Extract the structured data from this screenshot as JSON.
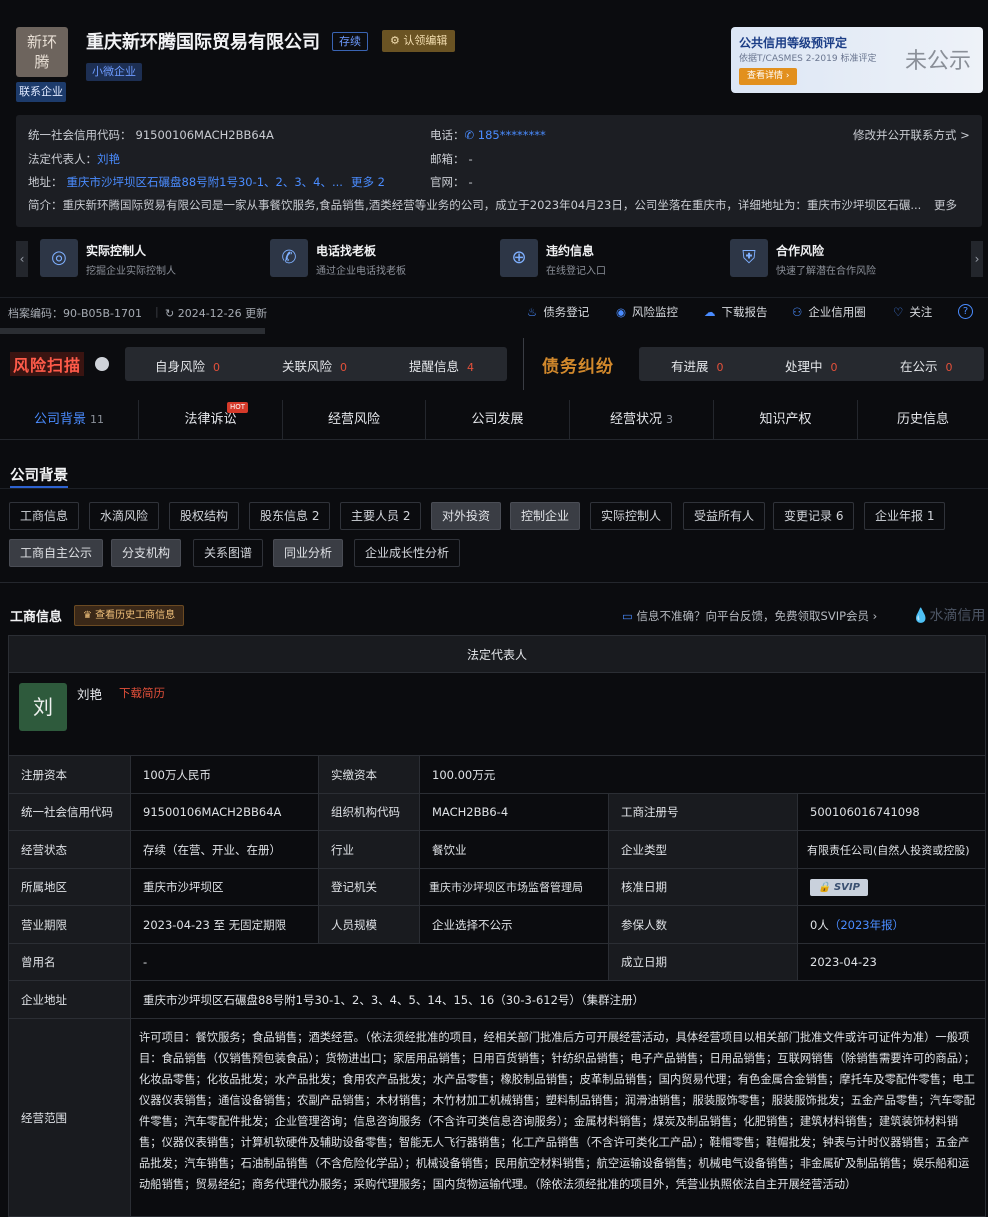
{
  "header": {
    "logo_text": "新环腾",
    "contact_badge": "联系企业",
    "company_name": "重庆新环腾国际贸易有限公司",
    "status": "存续",
    "claim": "认领编辑",
    "size_tag": "小微企业"
  },
  "credit_card": {
    "title": "公共信用等级预评定",
    "subtitle": "依据T/CASMES 2-2019 标准评定",
    "button": "查看详情",
    "result": "未公示"
  },
  "info": {
    "credit_code_label": "统一社会信用代码：",
    "credit_code": "91500106MACH2BB64A",
    "phone_label": "电话：",
    "phone": "185********",
    "modify": "修改并公开联系方式 >",
    "legal_label": "法定代表人：",
    "legal": "刘艳",
    "email_label": "邮箱：",
    "email": "-",
    "address_label": "地址：",
    "address": "重庆市沙坪坝区石碾盘88号附1号30-1、2、3、4、...",
    "address_more": "更多 2",
    "website_label": "官网：",
    "website": "-",
    "intro_label": "简介：",
    "intro": "重庆新环腾国际贸易有限公司是一家从事餐饮服务,食品销售,酒类经营等业务的公司，成立于2023年04月23日，公司坐落在重庆市，详细地址为：重庆市沙坪坝区石碾...",
    "intro_more": "更多"
  },
  "features": [
    {
      "title": "实际控制人",
      "sub": "挖掘企业实际控制人",
      "icon": "target-icon"
    },
    {
      "title": "电话找老板",
      "sub": "通过企业电话找老板",
      "icon": "phone-icon"
    },
    {
      "title": "违约信息",
      "sub": "在线登记入口",
      "icon": "user-add-icon"
    },
    {
      "title": "合作风险",
      "sub": "快速了解潜在合作风险",
      "icon": "shield-icon"
    }
  ],
  "archive": {
    "code_label": "档案编码：",
    "code": "90-B05B-1701",
    "updated": "2024-12-26 更新"
  },
  "toolbar": {
    "debt": "债务登记",
    "monitor": "风险监控",
    "report": "下载报告",
    "circle": "企业信用圈",
    "follow": "关注",
    "help": "?"
  },
  "risk": {
    "logo": "风险扫描",
    "items": [
      {
        "label": "自身风险",
        "count": "0"
      },
      {
        "label": "关联风险",
        "count": "0"
      },
      {
        "label": "提醒信息",
        "count": "4"
      }
    ],
    "debt_logo": "债务纠纷",
    "debt_items": [
      {
        "label": "有进展",
        "count": "0"
      },
      {
        "label": "处理中",
        "count": "0"
      },
      {
        "label": "在公示",
        "count": "0"
      }
    ]
  },
  "tabs": [
    {
      "label": "公司背景",
      "count": "11"
    },
    {
      "label": "法律诉讼",
      "count": "",
      "hot": "HOT"
    },
    {
      "label": "经营风险",
      "count": ""
    },
    {
      "label": "公司发展",
      "count": ""
    },
    {
      "label": "经营状况",
      "count": "3"
    },
    {
      "label": "知识产权",
      "count": ""
    },
    {
      "label": "历史信息",
      "count": ""
    }
  ],
  "section": {
    "title": "公司背景"
  },
  "chips": [
    "工商信息",
    "水滴风险",
    "股权结构",
    "股东信息 2",
    "主要人员 2",
    "对外投资",
    "控制企业",
    "实际控制人",
    "受益所有人",
    "变更记录 6",
    "企业年报 1",
    "工商自主公示",
    "分支机构",
    "关系图谱",
    "同业分析",
    "企业成长性分析"
  ],
  "biz": {
    "title": "工商信息",
    "history_btn": "查看历史工商信息",
    "feedback": "信息不准确？向平台反馈，免费领取SVIP会员 ›",
    "watermark": "水滴信用",
    "legal_header": "法定代表人",
    "avatar": "刘",
    "legal_name": "刘艳",
    "resume": "下载简历"
  },
  "table": {
    "reg_capital_k": "注册资本",
    "reg_capital": "100万人民币",
    "paid_k": "实缴资本",
    "paid": "100.00万元",
    "code_k": "统一社会信用代码",
    "code": "91500106MACH2BB64A",
    "org_k": "组织机构代码",
    "org": "MACH2BB6-4",
    "regno_k": "工商注册号",
    "regno": "500106016741098",
    "status_k": "经营状态",
    "status": "存续（在营、开业、在册）",
    "industry_k": "行业",
    "industry": "餐饮业",
    "type_k": "企业类型",
    "type": "有限责任公司(自然人投资或控股)",
    "area_k": "所属地区",
    "area": "重庆市沙坪坝区",
    "authority_k": "登记机关",
    "authority": "重庆市沙坪坝区市场监督管理局",
    "approve_k": "核准日期",
    "approve": "SVIP",
    "term_k": "营业期限",
    "term": "2023-04-23 至 无固定期限",
    "staff_k": "人员规模",
    "staff": "企业选择不公示",
    "insured_k": "参保人数",
    "insured": "0人",
    "insured_link": "（2023年报）",
    "former_k": "曾用名",
    "former": "-",
    "founded_k": "成立日期",
    "founded": "2023-04-23",
    "addr_k": "企业地址",
    "addr": "重庆市沙坪坝区石碾盘88号附1号30-1、2、3、4、5、14、15、16（30-3-612号）（集群注册）",
    "scope_k": "经营范围",
    "scope": "许可项目：餐饮服务；食品销售；酒类经营。（依法须经批准的项目，经相关部门批准后方可开展经营活动，具体经营项目以相关部门批准文件或许可证件为准）一般项目：食品销售（仅销售预包装食品）；货物进出口；家居用品销售；日用百货销售；针纺织品销售；电子产品销售；日用品销售；互联网销售（除销售需要许可的商品）；化妆品零售；化妆品批发；水产品批发；食用农产品批发；水产品零售；橡胶制品销售；皮革制品销售；国内贸易代理；有色金属合金销售；摩托车及零配件零售；电工仪器仪表销售；通信设备销售；农副产品销售；木材销售；木竹材加工机械销售；塑料制品销售；润滑油销售；服装服饰零售；服装服饰批发；五金产品零售；汽车零配件零售；汽车零配件批发；企业管理咨询；信息咨询服务（不含许可类信息咨询服务）；金属材料销售；煤炭及制品销售；化肥销售；建筑材料销售；建筑装饰材料销售；仪器仪表销售；计算机软硬件及辅助设备零售；智能无人飞行器销售；化工产品销售（不含许可类化工产品）；鞋帽零售；鞋帽批发；钟表与计时仪器销售；五金产品批发；汽车销售；石油制品销售（不含危险化学品）；机械设备销售；民用航空材料销售；航空运输设备销售；机械电气设备销售；非金属矿及制品销售；娱乐船和运动船销售；贸易经纪；商务代理代办服务；采购代理服务；国内货物运输代理。（除依法须经批准的项目外，凭营业执照依法自主开展经营活动）"
  }
}
